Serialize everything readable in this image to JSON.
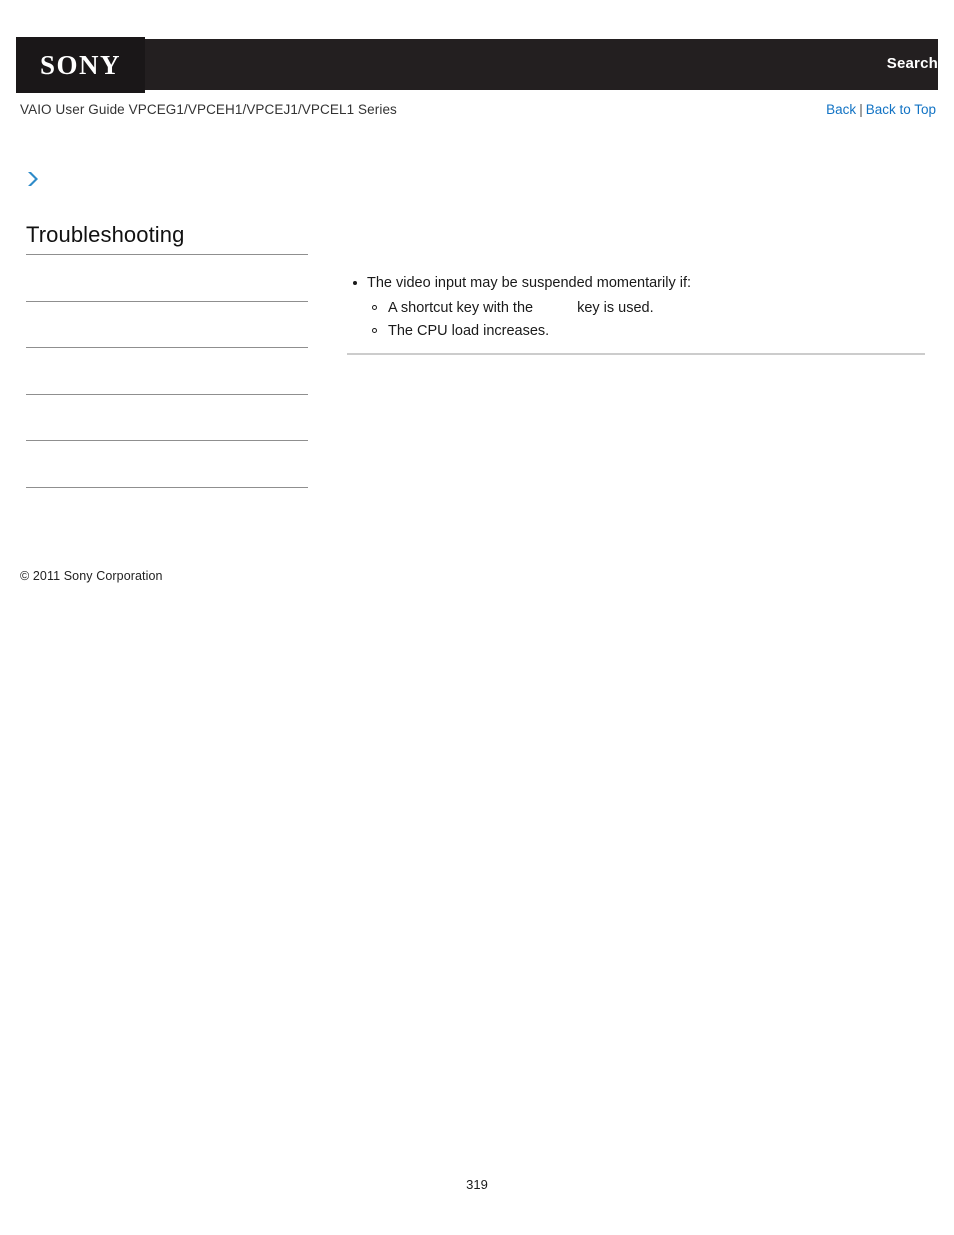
{
  "header": {
    "logo_text": "SONY",
    "search_label": "Search"
  },
  "subheader": {
    "title": "VAIO User Guide VPCEG1/VPCEH1/VPCEJ1/VPCEL1 Series",
    "nav": {
      "back": "Back",
      "separator": "|",
      "back_to_top": "Back to Top"
    }
  },
  "sidebar": {
    "expand_icon": "chevron-double-right-icon",
    "accent_color": "#2e8bc9",
    "title": "Troubleshooting",
    "items": [
      {
        "label": ""
      },
      {
        "label": ""
      },
      {
        "label": ""
      },
      {
        "label": ""
      },
      {
        "label": ""
      },
      {
        "label": ""
      }
    ],
    "copyright": "© 2011 Sony Corporation"
  },
  "content": {
    "bullets": [
      {
        "text": "The video input may be suspended momentarily if:",
        "subitems": [
          {
            "text_before": "A shortcut key with the",
            "text_after": "key is used."
          },
          {
            "text_before": "The CPU load increases.",
            "text_after": ""
          }
        ]
      }
    ]
  },
  "footer": {
    "page_number": "319"
  },
  "colors": {
    "header_bar": "#231f20",
    "logo_block": "#1a1718",
    "link": "#1273c4",
    "rule": "#cccccc",
    "sidebar_rule": "#8f8f8f"
  }
}
